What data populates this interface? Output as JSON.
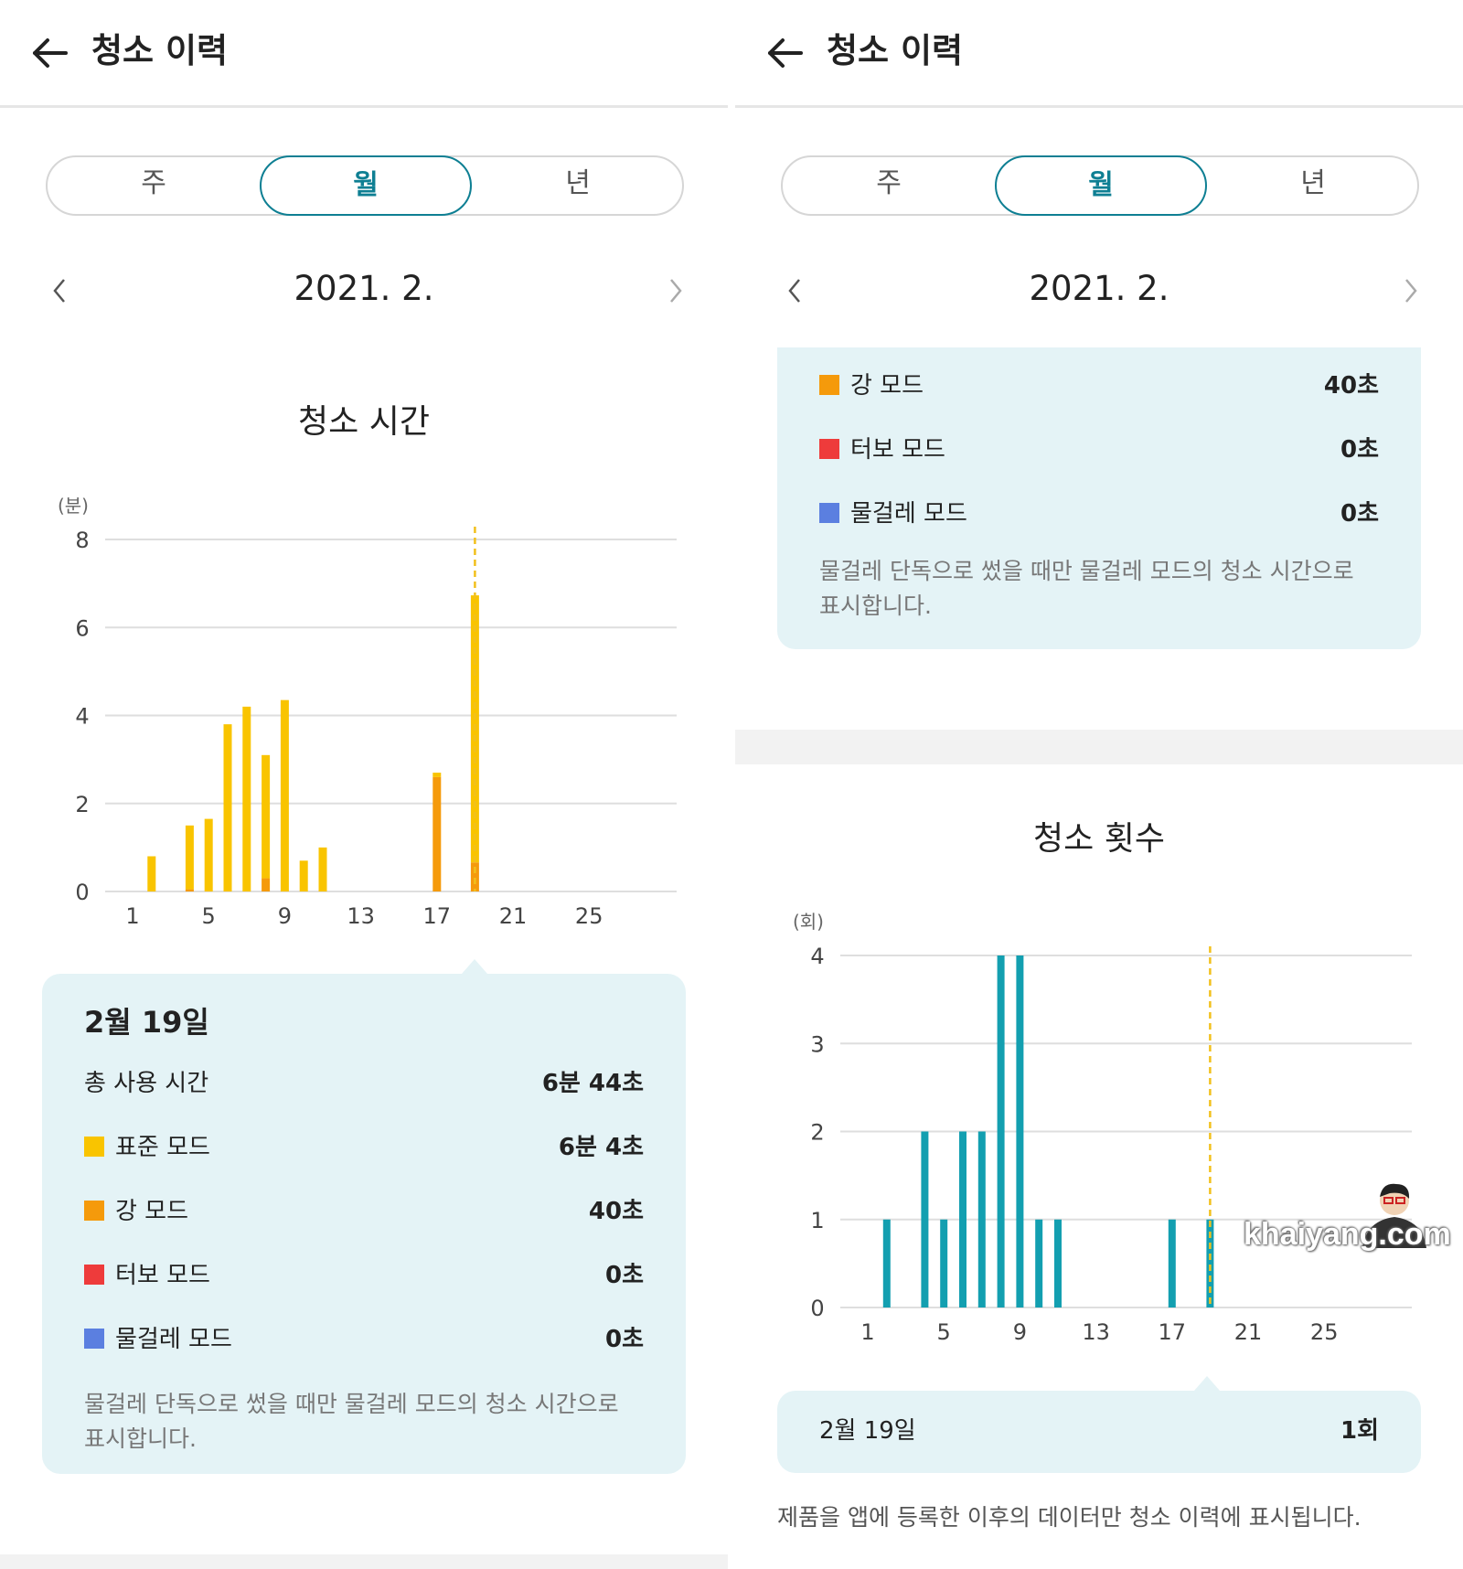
{
  "colors": {
    "teal": "#0e7f93",
    "standard": "#f9c400",
    "strong": "#f59a0b",
    "turbo": "#ee3b3b",
    "mop": "#5b7fe0",
    "count_bar": "#139fb0",
    "marker": "#f2c01c",
    "card_bg": "#e4f3f6"
  },
  "left": {
    "header": {
      "title": "청소 이력",
      "back_icon": "arrow-left-icon"
    },
    "tabs": [
      {
        "label": "주"
      },
      {
        "label": "월",
        "active": true
      },
      {
        "label": "년"
      }
    ],
    "date": "2021. 2.",
    "chart_title": "청소 시간",
    "chart_data": {
      "type": "bar",
      "stacked": true,
      "y_unit": "(분)",
      "ylim": [
        0,
        8
      ],
      "yticks": [
        "0",
        "2",
        "4",
        "6",
        "8"
      ],
      "xticks": [
        "1",
        "5",
        "9",
        "13",
        "17",
        "21",
        "25"
      ],
      "x_range": [
        1,
        28
      ],
      "highlight_day": 19,
      "series": [
        {
          "name": "강 모드",
          "color": "#f59a0b",
          "x": [
            4,
            8,
            17,
            19
          ],
          "values": [
            0.05,
            0.3,
            2.6,
            0.66
          ]
        },
        {
          "name": "표준 모드",
          "color": "#f9c400",
          "x": [
            2,
            4,
            5,
            6,
            7,
            8,
            9,
            10,
            11,
            17,
            19
          ],
          "values": [
            0.8,
            1.45,
            1.65,
            3.8,
            4.2,
            2.8,
            4.35,
            0.7,
            1.0,
            0.1,
            6.07
          ]
        }
      ]
    },
    "detail": {
      "date": "2월 19일",
      "rows": [
        {
          "label": "총 사용 시간",
          "value": "6분 44초"
        },
        {
          "label": "표준 모드",
          "value": "6분 4초",
          "color": "#f9c400"
        },
        {
          "label": "강 모드",
          "value": "40초",
          "color": "#f59a0b"
        },
        {
          "label": "터보 모드",
          "value": "0초",
          "color": "#ee3b3b"
        },
        {
          "label": "물걸레 모드",
          "value": "0초",
          "color": "#5b7fe0"
        }
      ],
      "note": "물걸레 단독으로 썼을 때만 물걸레 모드의 청소 시간으로 표시합니다."
    }
  },
  "right": {
    "header": {
      "title": "청소 이력",
      "back_icon": "arrow-left-icon"
    },
    "tabs": [
      {
        "label": "주"
      },
      {
        "label": "월",
        "active": true
      },
      {
        "label": "년"
      }
    ],
    "date": "2021. 2.",
    "legend_card": {
      "rows": [
        {
          "label": "강 모드",
          "value": "40초",
          "color": "#f59a0b"
        },
        {
          "label": "터보 모드",
          "value": "0초",
          "color": "#ee3b3b"
        },
        {
          "label": "물걸레 모드",
          "value": "0초",
          "color": "#5b7fe0"
        }
      ],
      "note": "물걸레 단독으로 썼을 때만 물걸레 모드의 청소 시간으로 표시합니다."
    },
    "chart_title": "청소 횟수",
    "chart_data": {
      "type": "bar",
      "y_unit": "(회)",
      "ylim": [
        0,
        4
      ],
      "yticks": [
        "0",
        "1",
        "2",
        "3",
        "4"
      ],
      "xticks": [
        "1",
        "5",
        "9",
        "13",
        "17",
        "21",
        "25"
      ],
      "x_range": [
        1,
        28
      ],
      "highlight_day": 19,
      "series": [
        {
          "name": "청소 횟수",
          "color": "#139fb0",
          "x": [
            2,
            4,
            5,
            6,
            7,
            8,
            9,
            10,
            11,
            17,
            19
          ],
          "values": [
            1,
            2,
            1,
            2,
            2,
            4,
            4,
            1,
            1,
            1,
            1
          ]
        }
      ]
    },
    "summary": {
      "date": "2월 19일",
      "value": "1회"
    },
    "footer_note": "제품을 앱에 등록한 이후의 데이터만 청소 이력에 표시됩니다.",
    "watermark": "khaiyang.com"
  }
}
